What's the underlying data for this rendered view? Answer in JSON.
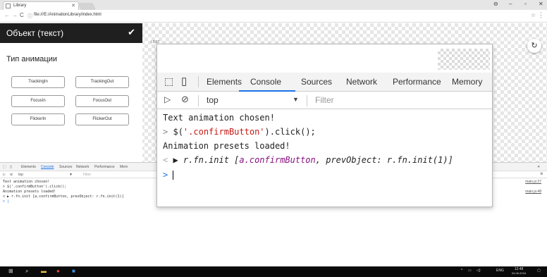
{
  "browser": {
    "tab_title": "Library",
    "url": "file:///E:/AnimationLibrary/index.html"
  },
  "panel": {
    "title": "Объект (текст)",
    "subtitle": "Тип анимации",
    "buttons": [
      "TrackingIn",
      "TrackingOut",
      "FocusIn",
      "FocusOut",
      "FlickerIn",
      "FlickerOut"
    ]
  },
  "viewport": {
    "small_label": "LBST"
  },
  "devtools_bg": {
    "tabs": [
      "Elements",
      "Console",
      "Sources",
      "Network",
      "Performance",
      "Mem"
    ],
    "context": "top",
    "filter_placeholder": "Filter",
    "lines": [
      "Text animation chosen!",
      "> $('.confirmButton').click();",
      "Animation presets loaded!",
      "< ▶ r.fn.init [a.confirmButton, prevObject: r.fn.init(1)]",
      "> |"
    ],
    "sources": [
      "main.js:27",
      "main.js:48"
    ]
  },
  "devtools_overlay": {
    "tabs": [
      "Elements",
      "Console",
      "Sources",
      "Network",
      "Performance",
      "Memory"
    ],
    "active_tab": "Console",
    "context": "top",
    "filter_placeholder": "Filter",
    "lines": {
      "l1": "Text animation chosen!",
      "l2_prompt": ">",
      "l2_pre": "$(",
      "l2_str": "'.confirmButton'",
      "l2_post": ").click();",
      "l3": "Animation presets loaded!",
      "l4_prompt": "<",
      "l4_obj": "▶ r.fn.init [",
      "l4_el": "a.confirmButton",
      "l4_rest": ", prevObject: r.fn.init(1)]",
      "l5_prompt": ">"
    }
  },
  "taskbar": {
    "language": "ENG",
    "time": "12:48",
    "date": "04.06.2018"
  },
  "colors": {
    "header_bg": "#1f1f1f",
    "console_accent": "#1a73e8",
    "string_color": "#c41a16",
    "element_color": "#881280"
  }
}
